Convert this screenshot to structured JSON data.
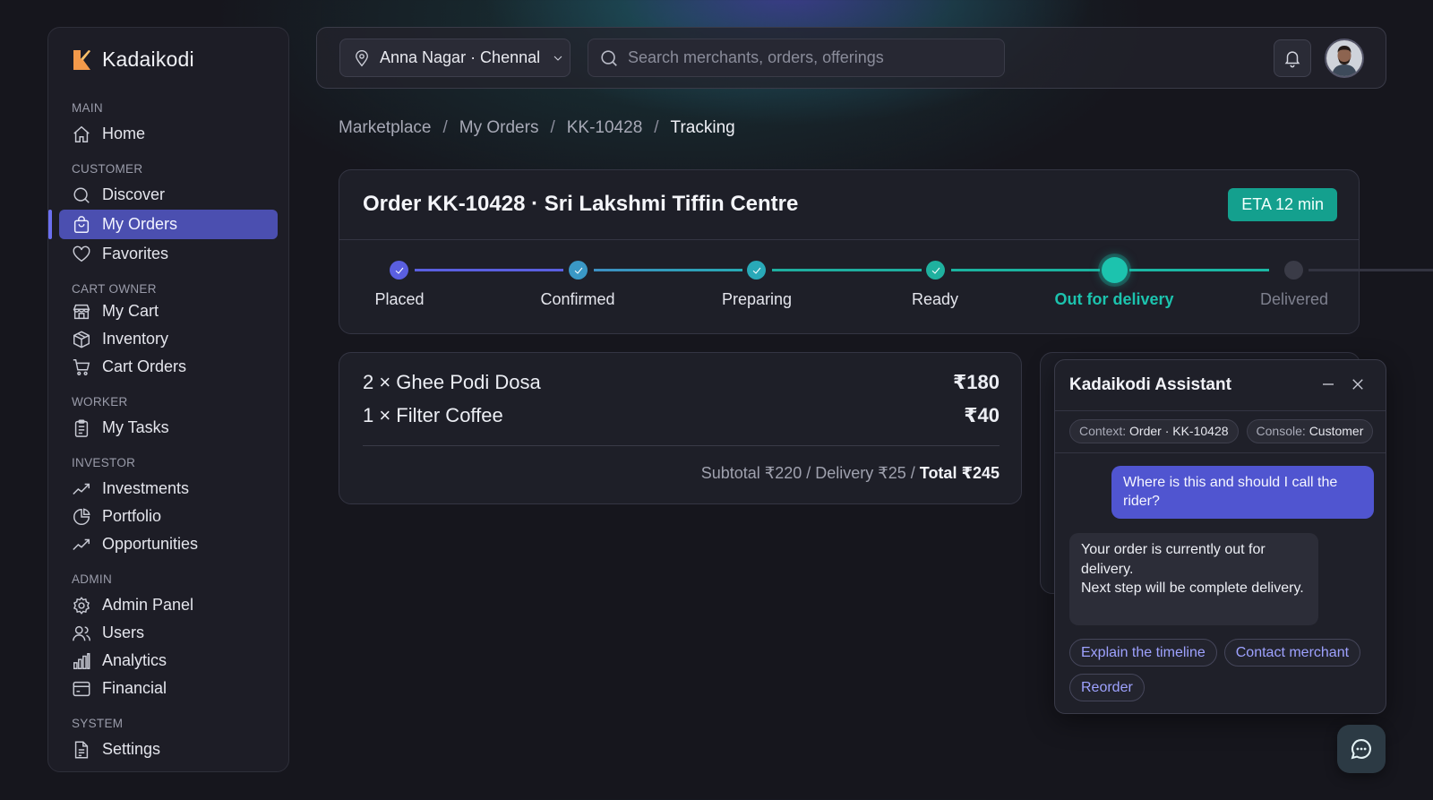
{
  "brand": {
    "name": "Kadaikodi"
  },
  "sidebar": {
    "sections": [
      {
        "title": "MAIN",
        "items": [
          {
            "label": "Home",
            "icon": "home-icon"
          }
        ]
      },
      {
        "title": "CUSTOMER",
        "items": [
          {
            "label": "Discover",
            "icon": "search-icon"
          },
          {
            "label": "My Orders",
            "icon": "bag-icon",
            "active": true
          },
          {
            "label": "Favorites",
            "icon": "heart-icon"
          }
        ]
      },
      {
        "title": "CART OWNER",
        "items": [
          {
            "label": "My Cart",
            "icon": "store-icon"
          },
          {
            "label": "Inventory",
            "icon": "box-icon"
          },
          {
            "label": "Cart Orders",
            "icon": "cart-icon"
          }
        ]
      },
      {
        "title": "WORKER",
        "items": [
          {
            "label": "My Tasks",
            "icon": "clipboard-icon"
          }
        ]
      },
      {
        "title": "INVESTOR",
        "items": [
          {
            "label": "Investments",
            "icon": "trend-icon"
          },
          {
            "label": "Portfolio",
            "icon": "pie-icon"
          },
          {
            "label": "Opportunities",
            "icon": "trend-icon"
          }
        ]
      },
      {
        "title": "ADMIN",
        "items": [
          {
            "label": "Admin Panel",
            "icon": "gear-icon"
          },
          {
            "label": "Users",
            "icon": "users-icon"
          },
          {
            "label": "Analytics",
            "icon": "bars-icon"
          },
          {
            "label": "Financial",
            "icon": "wallet-icon"
          }
        ]
      },
      {
        "title": "SYSTEM",
        "items": [
          {
            "label": "Settings",
            "icon": "document-icon"
          }
        ]
      }
    ]
  },
  "topbar": {
    "location": "Anna Nagar · Chennal",
    "search_placeholder": "Search merchants, orders, offerings"
  },
  "breadcrumb": [
    "Marketplace",
    "My Orders",
    "KK-10428",
    "Tracking"
  ],
  "order": {
    "title": "Order KK-10428 · Sri Lakshmi Tiffin Centre",
    "eta": "ETA 12 min",
    "steps": [
      {
        "label": "Placed",
        "state": "done"
      },
      {
        "label": "Confirmed",
        "state": "done"
      },
      {
        "label": "Preparing",
        "state": "done"
      },
      {
        "label": "Ready",
        "state": "done"
      },
      {
        "label": "Out for delivery",
        "state": "current"
      },
      {
        "label": "Delivered",
        "state": "pending"
      }
    ],
    "items": [
      {
        "name": "2 × Ghee Podi Dosa",
        "price": "₹180"
      },
      {
        "name": "1 × Filter Coffee",
        "price": "₹40"
      }
    ],
    "totals_prefix": "Subtotal ₹220 / Delivery ₹25 / ",
    "total": "Total ₹245"
  },
  "assistant": {
    "title": "Kadaikodi Assistant",
    "context_label": "Context:",
    "context_value": "Order · KK-10428",
    "console_label": "Console:",
    "console_value": "Customer",
    "user_message": "Where is this and should I call the rider?",
    "bot_message_1": "Your order is currently out for delivery.",
    "bot_message_2": "Next step will be complete delivery.",
    "chips": [
      "Explain the timeline",
      "Contact merchant",
      "Reorder"
    ]
  },
  "colors": {
    "accent": "#5055d0",
    "teal": "#14a08e",
    "timeline_blue": "#5a5fe0",
    "timeline_teal": "#1bb7a4"
  }
}
